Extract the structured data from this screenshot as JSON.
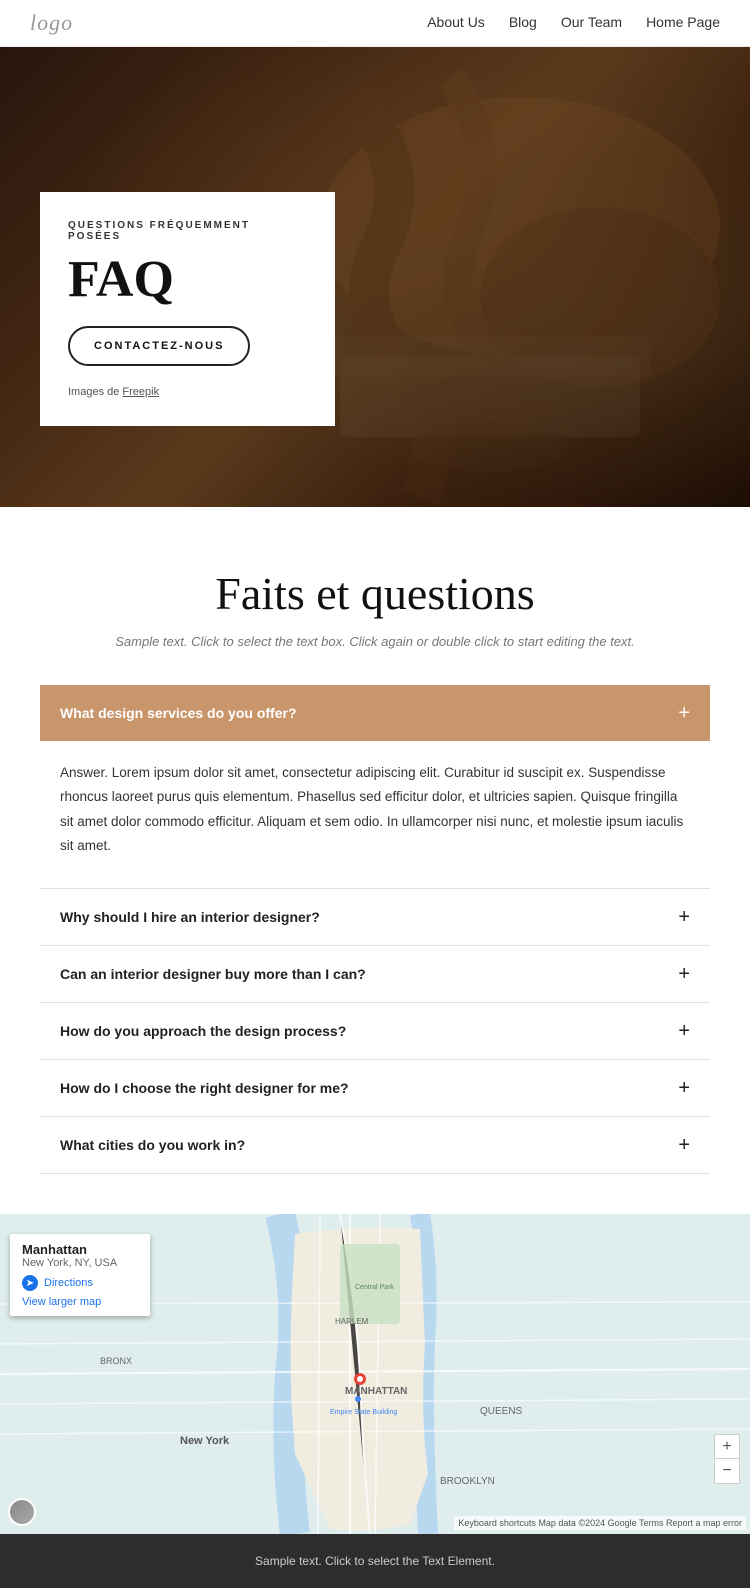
{
  "navbar": {
    "logo": "logo",
    "links": [
      {
        "label": "About Us",
        "href": "#"
      },
      {
        "label": "Blog",
        "href": "#"
      },
      {
        "label": "Our Team",
        "href": "#"
      },
      {
        "label": "Home Page",
        "href": "#"
      }
    ]
  },
  "hero": {
    "subtitle": "QUESTIONS FRÉQUEMMENT POSÉES",
    "title": "FAQ",
    "button_label": "CONTACTEZ-NOUS",
    "image_credit_text": "Images de ",
    "image_credit_link": "Freepik"
  },
  "main": {
    "section_title": "Faits et questions",
    "section_subtitle": "Sample text. Click to select the text box. Click again or double click to start editing the text.",
    "faq_items": [
      {
        "question": "What design services do you offer?",
        "answer": "Answer. Lorem ipsum dolor sit amet, consectetur adipiscing elit. Curabitur id suscipit ex. Suspendisse rhoncus laoreet purus quis elementum. Phasellus sed efficitur dolor, et ultricies sapien. Quisque fringilla sit amet dolor commodo efficitur. Aliquam et sem odio. In ullamcorper nisi nunc, et molestie ipsum iaculis sit amet.",
        "open": true
      },
      {
        "question": "Why should I hire an interior designer?",
        "answer": "",
        "open": false
      },
      {
        "question": "Can an interior designer buy more than I can?",
        "answer": "",
        "open": false
      },
      {
        "question": "How do you approach the design process?",
        "answer": "",
        "open": false
      },
      {
        "question": "How do I choose the right designer for me?",
        "answer": "",
        "open": false
      },
      {
        "question": "What cities do you work in?",
        "answer": "",
        "open": false
      }
    ]
  },
  "map": {
    "place_name": "Manhattan",
    "place_sub": "New York, NY, USA",
    "directions_label": "Directions",
    "larger_map_label": "View larger map",
    "attribution": "Keyboard shortcuts  Map data ©2024 Google  Terms  Report a map error"
  },
  "footer": {
    "sample_text": "Sample text. Click to select the Text Element."
  }
}
